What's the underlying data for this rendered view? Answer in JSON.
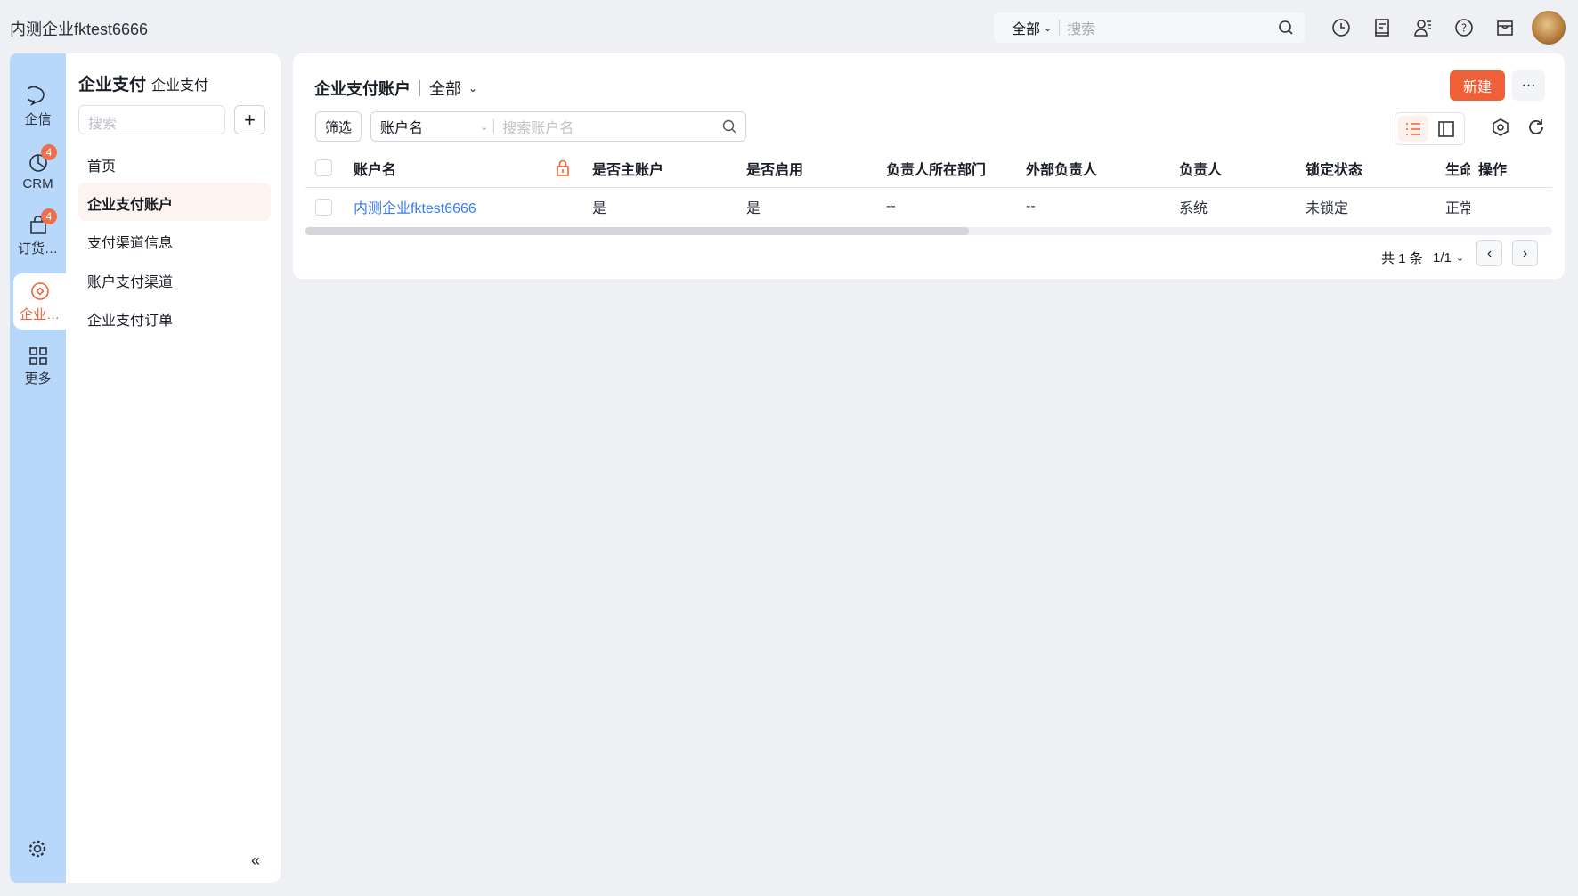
{
  "app": {
    "title": "内测企业fktest6666"
  },
  "global_search": {
    "scope": "全部",
    "placeholder": "搜索"
  },
  "rail": [
    {
      "label": "企信",
      "icon": "chat-icon"
    },
    {
      "label": "CRM",
      "icon": "pie-chart-icon",
      "badge": "4"
    },
    {
      "label": "订货…",
      "icon": "bag-icon",
      "badge": "4"
    },
    {
      "label": "企业…",
      "icon": "payment-icon",
      "active": true
    },
    {
      "label": "更多",
      "icon": "grid-icon"
    }
  ],
  "panel": {
    "title": "企业支付",
    "subtitle": "企业支付",
    "search_placeholder": "搜索",
    "items": [
      "首页",
      "企业支付账户",
      "支付渠道信息",
      "账户支付渠道",
      "企业支付订单"
    ],
    "active": 1
  },
  "main": {
    "title": "企业支付账户",
    "scope": "全部",
    "new_label": "新建",
    "filter_label": "筛选",
    "search_field": "账户名",
    "search_placeholder": "搜索账户名",
    "columns": [
      "账户名",
      "是否主账户",
      "是否启用",
      "负责人所在部门",
      "外部负责人",
      "负责人",
      "锁定状态",
      "生命",
      "操作"
    ],
    "rows": [
      [
        "内测企业fktest6666",
        "是",
        "是",
        "--",
        "--",
        "系统",
        "未锁定",
        "正常"
      ]
    ],
    "pager": {
      "total": "共 1 条",
      "page": "1/1"
    }
  },
  "colors": {
    "accent": "#ed6038",
    "link": "#3a7bf0",
    "rail": "#b8d8fb"
  }
}
